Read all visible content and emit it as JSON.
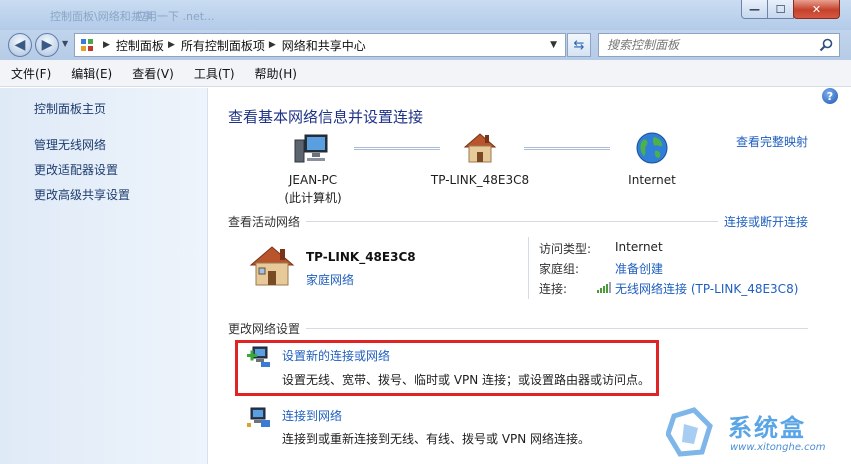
{
  "titlebar": {
    "ghost_left": "控制面板\\网络和共享",
    "ghost_right": "应用一下 .net...",
    "min_glyph": "—",
    "max_glyph": "☐",
    "close_glyph": "✕"
  },
  "address": {
    "crumbs": [
      "控制面板",
      "所有控制面板项",
      "网络和共享中心"
    ],
    "search_placeholder": "搜索控制面板"
  },
  "menu": [
    "文件(F)",
    "编辑(E)",
    "查看(V)",
    "工具(T)",
    "帮助(H)"
  ],
  "sidebar": {
    "home": "控制面板主页",
    "links": [
      "管理无线网络",
      "更改适配器设置",
      "更改高级共享设置"
    ]
  },
  "main": {
    "title": "查看基本网络信息并设置连接",
    "full_map": "查看完整映射",
    "nodes": [
      {
        "name": "JEAN-PC",
        "sub": "(此计算机)",
        "icon": "computer-icon"
      },
      {
        "name": "TP-LINK_48E3C8",
        "icon": "house-icon"
      },
      {
        "name": "Internet",
        "icon": "globe-icon"
      }
    ],
    "active_section": "查看活动网络",
    "connect_link": "连接或断开连接",
    "network": {
      "name": "TP-LINK_48E3C8",
      "type": "家庭网络",
      "access_key": "访问类型:",
      "access_val": "Internet",
      "homegroup_key": "家庭组:",
      "homegroup_val": "准备创建",
      "connection_key": "连接:",
      "connection_val": "无线网络连接 (TP-LINK_48E3C8)"
    },
    "change_section": "更改网络设置",
    "tasks": [
      {
        "title": "设置新的连接或网络",
        "desc": "设置无线、宽带、拨号、临时或 VPN 连接；或设置路由器或访问点。",
        "icon": "new-connection-icon"
      },
      {
        "title": "连接到网络",
        "desc": "连接到或重新连接到无线、有线、拨号或 VPN 网络连接。",
        "icon": "connect-network-icon"
      }
    ]
  },
  "watermark": {
    "text": "系统盒",
    "url": "www.xitonghe.com"
  },
  "colors": {
    "link": "#1f5fbf",
    "title": "#1e3287",
    "highlight": "#e02424"
  }
}
